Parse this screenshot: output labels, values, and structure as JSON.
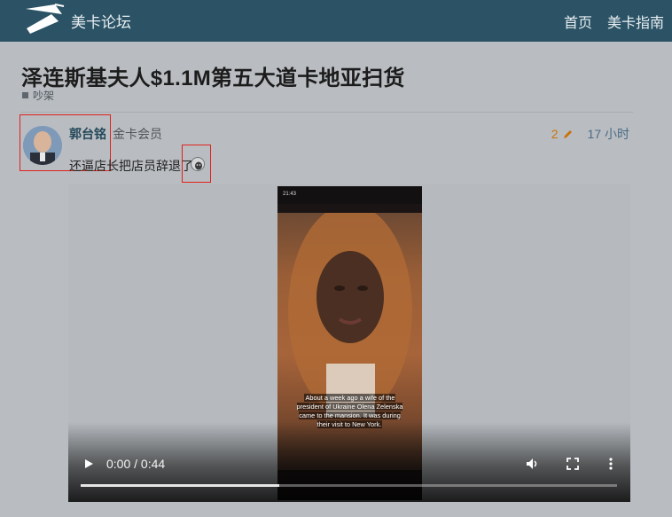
{
  "header": {
    "site_title": "美卡论坛",
    "nav": [
      "首页",
      "美卡指南"
    ]
  },
  "topic": {
    "title": "泽连斯基夫人$1.1M第五大道卡地亚扫货",
    "category": "吵架"
  },
  "post": {
    "username": "郭台铭",
    "user_title": "金卡会员",
    "edit_count": "2",
    "time_ago": "17 小时",
    "text": "还逼店长把店员辞退了"
  },
  "video": {
    "caption": "About a week ago a wife of the president of Ukraine Olena Zelenska came to the mansion. It was during their visit to New York.",
    "phone_time": "21:43",
    "time_display": "0:00 / 0:44",
    "progress_fraction": 0.37
  },
  "colors": {
    "header_bg": "#2b5365",
    "page_bg": "#b9bdc1",
    "edit_accent": "#c9720a",
    "highlight": "#e0211b"
  }
}
